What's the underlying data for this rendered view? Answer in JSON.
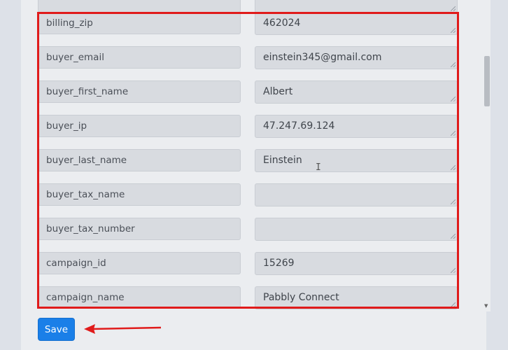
{
  "fields": [
    {
      "key": "billing_zip",
      "value": "462024"
    },
    {
      "key": "buyer_email",
      "value": "einstein345@gmail.com"
    },
    {
      "key": "buyer_first_name",
      "value": "Albert"
    },
    {
      "key": "buyer_ip",
      "value": "47.247.69.124"
    },
    {
      "key": "buyer_last_name",
      "value": "Einstein"
    },
    {
      "key": "buyer_tax_name",
      "value": ""
    },
    {
      "key": "buyer_tax_number",
      "value": ""
    },
    {
      "key": "campaign_id",
      "value": "15269"
    },
    {
      "key": "campaign_name",
      "value": "Pabbly Connect"
    }
  ],
  "save_button": {
    "label": "Save"
  },
  "colors": {
    "highlight_box": "#e01b1b",
    "annotation_arrow": "#e01b1b",
    "save_button": "#1a7fe8"
  }
}
